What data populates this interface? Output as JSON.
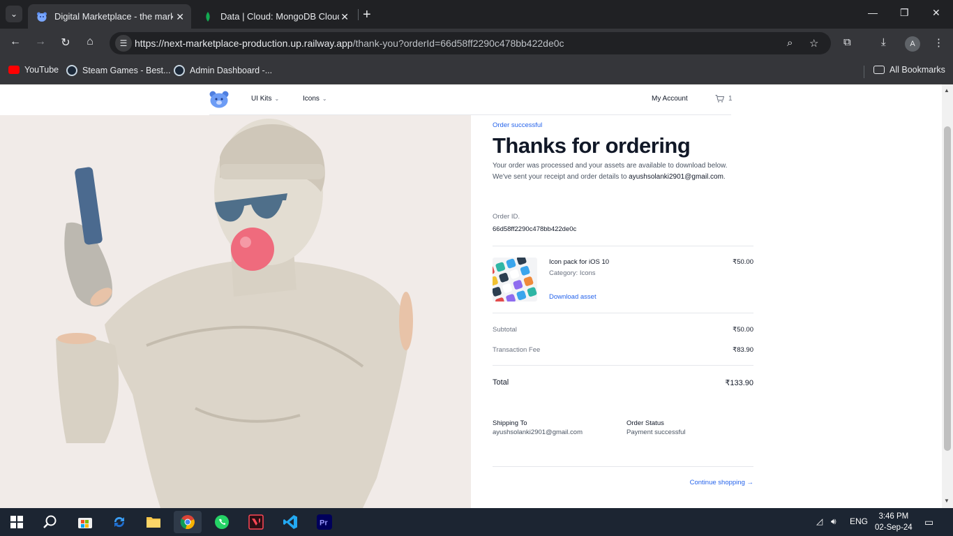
{
  "browser": {
    "tabs": [
      {
        "title": "Digital Marketplace - the marke",
        "active": true
      },
      {
        "title": "Data | Cloud: MongoDB Cloud",
        "active": false
      }
    ],
    "url_host": "https://next-marketplace-production.up.railway.app",
    "url_path": "/thank-you?orderId=66d58ff2290c478bb422de0c",
    "avatar_letter": "A",
    "bookmarks": [
      {
        "label": "YouTube"
      },
      {
        "label": "Steam Games - Best..."
      },
      {
        "label": "Admin Dashboard -..."
      }
    ],
    "all_bookmarks": "All Bookmarks"
  },
  "site": {
    "nav": {
      "ui_kits": "UI Kits",
      "icons": "Icons",
      "my_account": "My Account",
      "cart_count": "1"
    },
    "order": {
      "status_label": "Order successful",
      "headline": "Thanks for ordering",
      "lead_line1": "Your order was processed and your assets are available to download below.",
      "lead_line2_prefix": "We've sent your receipt and order details to ",
      "email": "ayushsolanki2901@gmail.com",
      "lead_line2_suffix": ".",
      "order_id_label": "Order ID.",
      "order_id": "66d58ff2290c478bb422de0c",
      "product_name": "Icon pack for iOS 10",
      "product_category": "Category: Icons",
      "product_price": "₹50.00",
      "download_label": "Download asset",
      "subtotal_label": "Subtotal",
      "subtotal_value": "₹50.00",
      "fee_label": "Transaction Fee",
      "fee_value": "₹83.90",
      "total_label": "Total",
      "total_value": "₹133.90",
      "shipping_label": "Shipping To",
      "shipping_value": "ayushsolanki2901@gmail.com",
      "status_heading": "Order Status",
      "status_value": "Payment successful",
      "continue_label": "Continue shopping →"
    }
  },
  "taskbar": {
    "language": "ENG",
    "time": "3:46 PM",
    "date": "02-Sep-24"
  },
  "colors": {
    "accent": "#2563eb",
    "hero_bg": "#f1ebe8",
    "chrome_dark": "#202124",
    "chrome_toolbar": "#35363a",
    "taskbar": "#1c2532"
  }
}
